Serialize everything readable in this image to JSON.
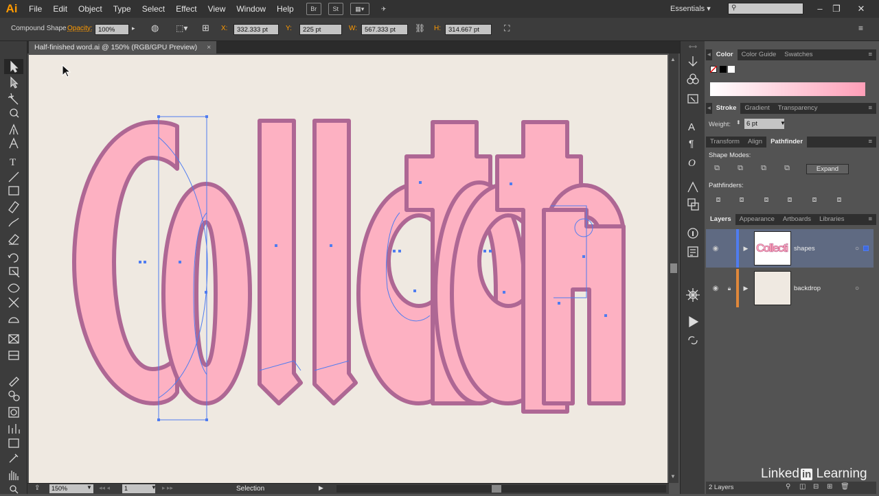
{
  "app": {
    "logo": "Ai"
  },
  "menu": [
    "File",
    "Edit",
    "Object",
    "Type",
    "Select",
    "Effect",
    "View",
    "Window",
    "Help"
  ],
  "menu_buttons": [
    "Br",
    "St"
  ],
  "workspace": "Essentials",
  "control": {
    "selection_type": "Compound Shape",
    "opacity_label": "Opacity:",
    "opacity_value": "100%",
    "x_label": "X:",
    "x_value": "332.333 pt",
    "y_label": "Y:",
    "y_value": "225 pt",
    "w_label": "W:",
    "w_value": "567.333 pt",
    "h_label": "H:",
    "h_value": "314.667 pt"
  },
  "document": {
    "tab_title": "Half-finished word.ai @ 150% (RGB/GPU Preview)",
    "close_glyph": "×"
  },
  "status": {
    "zoom": "150%",
    "artboard_num": "1",
    "tool_name": "Selection"
  },
  "panels": {
    "color_tabs": [
      "Color",
      "Color Guide",
      "Swatches"
    ],
    "stroke_tabs": [
      "Stroke",
      "Gradient",
      "Transparency"
    ],
    "weight_label": "Weight:",
    "weight_value": "6 pt",
    "path_tabs": [
      "Transform",
      "Align",
      "Pathfinder"
    ],
    "shape_modes_label": "Shape Modes:",
    "expand_label": "Expand",
    "pathfinders_label": "Pathfinders:",
    "layer_tabs": [
      "Layers",
      "Appearance",
      "Artboards",
      "Libraries"
    ],
    "layers": [
      {
        "name": "shapes",
        "thumb_text": "Collecti"
      },
      {
        "name": "backdrop"
      }
    ],
    "layer_count": "2 Layers"
  },
  "watermark": {
    "brand_a": "Linked",
    "brand_in": "in",
    "brand_b": " Learning"
  },
  "colors": {
    "artboard": "#efe9e1",
    "shape_fill": "#ffadc0",
    "shape_stroke": "#a95d8e",
    "selection": "#4f7cf0",
    "accent": "#ff9a00"
  }
}
